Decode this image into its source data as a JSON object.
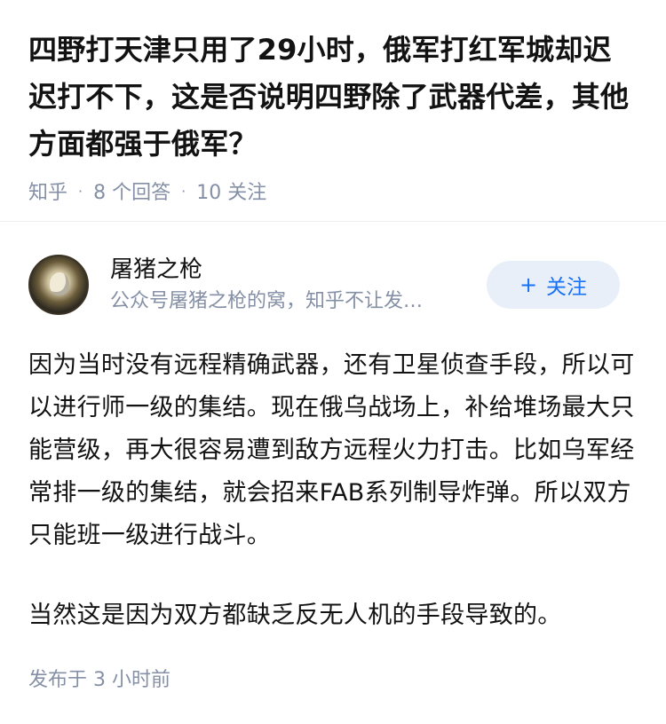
{
  "question": {
    "title": "四野打天津只用了29小时，俄军打红军城却迟迟打不下，这是否说明四野除了武器代差，其他方面都强于俄军？",
    "source": "知乎",
    "answers_count": "8 个回答",
    "followers_count": "10 关注"
  },
  "author": {
    "name": "屠猪之枪",
    "bio": "公众号屠猪之枪的窝，知乎不让发…",
    "follow_label": "关注",
    "follow_icon": "+"
  },
  "answer": {
    "paragraphs": [
      "因为当时没有远程精确武器，还有卫星侦查手段，所以可以进行师一级的集结。现在俄乌战场上，补给堆场最大只能营级，再大很容易遭到敌方远程火力打击。比如乌军经常排一级的集结，就会招来FAB系列制导炸弹。所以双方只能班一级进行战斗。",
      "当然这是因为双方都缺乏反无人机的手段导致的。"
    ]
  },
  "footer": {
    "published": "发布于  3 小时前"
  }
}
